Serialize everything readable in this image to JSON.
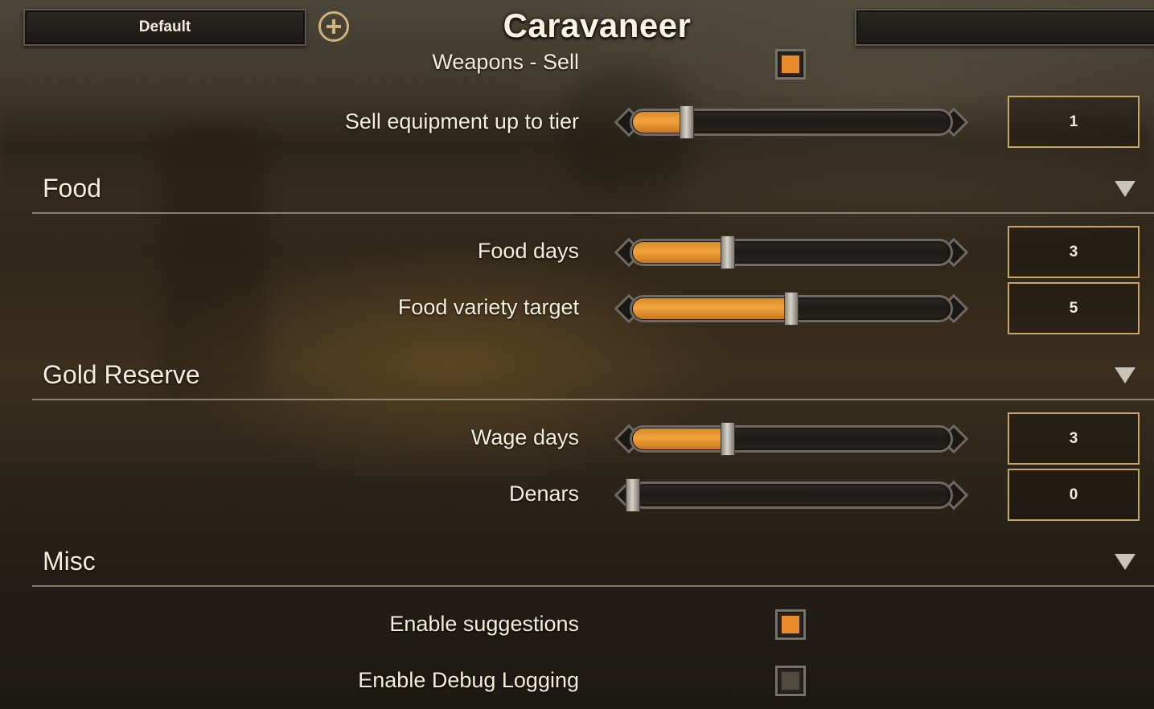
{
  "header": {
    "preset_label": "Default",
    "title": "Caravaneer",
    "search_value": ""
  },
  "top_partial": {
    "label": "Weapons - Sell",
    "checked": true
  },
  "rows_top": [
    {
      "label": "Sell equipment up to tier",
      "value": "1",
      "fill_fraction": 0.17
    }
  ],
  "sections": [
    {
      "title": "Food",
      "rows": [
        {
          "label": "Food days",
          "value": "3",
          "fill_fraction": 0.3
        },
        {
          "label": "Food variety target",
          "value": "5",
          "fill_fraction": 0.5
        }
      ]
    },
    {
      "title": "Gold Reserve",
      "rows": [
        {
          "label": "Wage days",
          "value": "3",
          "fill_fraction": 0.3
        },
        {
          "label": "Denars",
          "value": "0",
          "fill_fraction": 0.0
        }
      ]
    },
    {
      "title": "Misc",
      "toggles": [
        {
          "label": "Enable suggestions",
          "checked": true
        },
        {
          "label": "Enable Debug Logging",
          "checked": false
        }
      ]
    }
  ],
  "colors": {
    "accent": "#ea8a2a",
    "frame_gold": "#c8a565",
    "text": "#f7efdc"
  },
  "icons": {
    "add": "plus-circle-icon",
    "collapse": "triangle-down-icon"
  }
}
